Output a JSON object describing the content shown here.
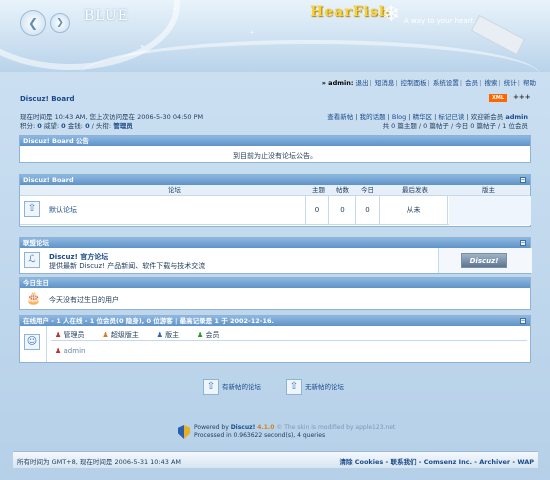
{
  "header": {
    "logo_text": "BLUE",
    "brand": "HearFish",
    "tagline": "A way to your heart...",
    "back_glyph": "❮",
    "forward_glyph": "❯"
  },
  "topnav": {
    "user_prefix": "» admin:",
    "links": [
      "退出",
      "短消息",
      "控制面板",
      "系统设置",
      "会员",
      "搜索",
      "统计",
      "帮助"
    ]
  },
  "board": {
    "name": "Discuz! Board",
    "xml_badge": "XML",
    "dots": "+++"
  },
  "info": {
    "visit_line": "现在时间是 10:43 AM, 您上次访问是在 2006-5-30 04:50 PM",
    "points_label": "积分:",
    "points": "0",
    "prestige_label": "威望:",
    "prestige": "0",
    "money_label": "金钱:",
    "money": "0",
    "title_label": "头衔:",
    "title": "管理员",
    "right_links": [
      "查看新帖",
      "我的话题",
      "Blog",
      "精华区",
      "标记已读",
      "欢迎新会员"
    ],
    "newest_member": "admin",
    "stats_line": "共 0 篇主题 / 0 篇帖子 / 今日 0 篇帖子 / 1 位会员"
  },
  "announcement": {
    "header": "Discuz! Board 公告",
    "text": "到目前为止没有论坛公告。"
  },
  "forum": {
    "header": "Discuz! Board",
    "columns": [
      "论坛",
      "主题",
      "帖数",
      "今日",
      "最后发表",
      "版主"
    ],
    "rows": [
      {
        "name": "默认论坛",
        "topics": "0",
        "posts": "0",
        "today": "0",
        "last": "从未",
        "moderator": ""
      }
    ]
  },
  "league": {
    "header": "联盟论坛",
    "name": "Discuz! 官方论坛",
    "desc": "提供最新 Discuz! 产品新闻、软件下载与技术交流",
    "logo": "Discuz!"
  },
  "birthday": {
    "header": "今日生日",
    "text": "今天没有过生日的用户"
  },
  "online": {
    "header": "在线用户 - 1 人在线 - 1 位会员(0 隐身), 0 位游客 | 最高记录是 1 于 2002-12-16.",
    "legend": [
      "管理员",
      "超级版主",
      "版主",
      "会员"
    ],
    "legend_colors": [
      "#c03030",
      "#d08020",
      "#3060c0",
      "#2a9a2a"
    ],
    "users": [
      "admin"
    ]
  },
  "footer": {
    "new_posts": "有新帖的论坛",
    "no_new_posts": "无新帖的论坛",
    "powered_by": "Powered by",
    "product": "Discuz!",
    "version": "4.1.0",
    "skin_credit": "© The skin is modified by apple123.net",
    "processed": "Processed in 0.963622 second(s), 4 queries"
  },
  "bottombar": {
    "timezone_text": "所有时间为 GMT+8, 现在时间是 2006-5-31 10:43 AM",
    "links": [
      "清除",
      "Cookies",
      "联系我们",
      "Comsenz Inc.",
      "Archiver",
      "WAP"
    ]
  }
}
